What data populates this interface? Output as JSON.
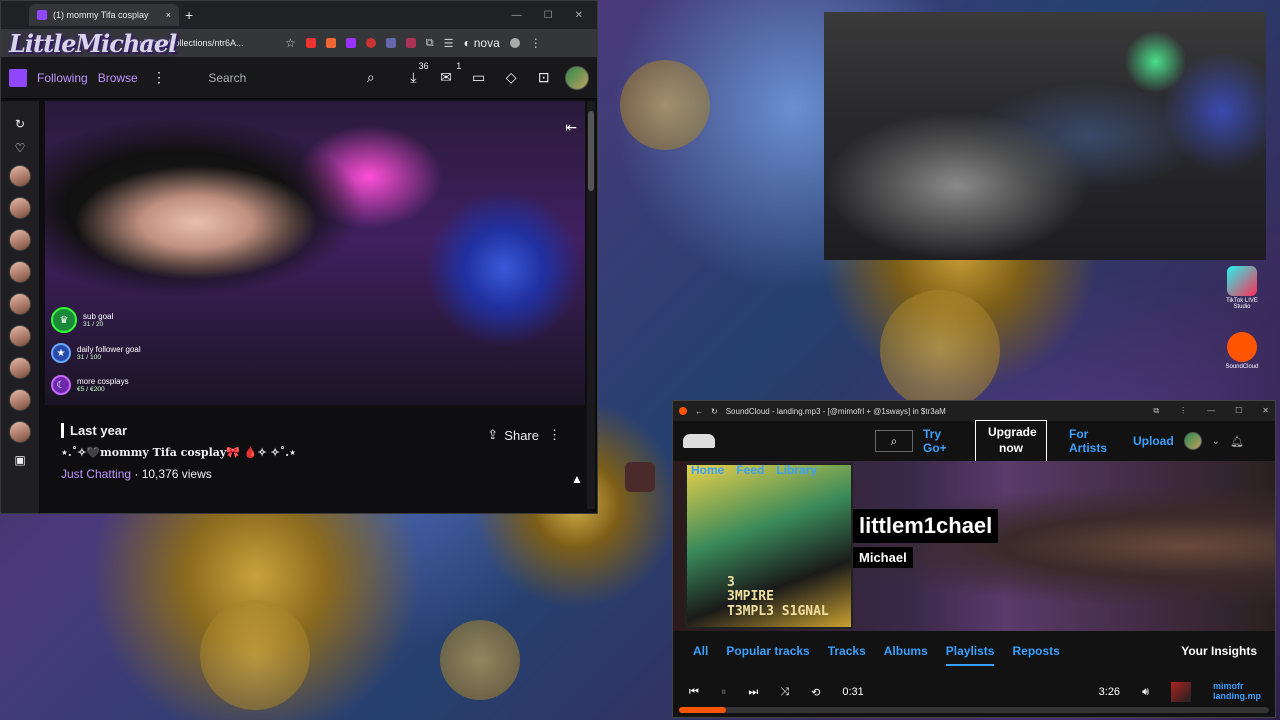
{
  "browser": {
    "tab_title": "(1) mommy Tifa cosplay",
    "tab_close": "×",
    "new_tab": "+",
    "url": "twitch.tv/collections/ntr6A...",
    "nova_label": "nova",
    "window_controls": [
      "—",
      "☐",
      "✕"
    ],
    "logo_text": "LittleMichael"
  },
  "twitch": {
    "nav": {
      "following": "Following",
      "browse": "Browse",
      "search_placeholder": "Search",
      "badge_count_a": "36",
      "badge_count_b": "1"
    },
    "goals": [
      {
        "label": "sub goal",
        "value": "31 / 20"
      },
      {
        "label": "daily follower goal",
        "value": "31 / 100"
      },
      {
        "label": "more cosplays",
        "value": "€5 / €200"
      }
    ],
    "video": {
      "when": "Last year",
      "title": "⋆.˚✧🖤mommy Tifa cosplay🎀 🩸✧ ✧˚.⋆",
      "category": "Just Chatting",
      "views": " · 10,376 views",
      "share_label": "Share"
    }
  },
  "desktop": {
    "tiktok_label": "TikTok LIVE Studio",
    "soundcloud_label": "SoundCloud"
  },
  "soundcloud": {
    "window_title": "SoundCloud - landing.mp3 - [@mimofrl + @1sways] in $tr3aM",
    "nav": {
      "try_go": "Try Go+",
      "upgrade": "Upgrade now",
      "for_artists": "For Artists",
      "upload": "Upload"
    },
    "banner_nav": [
      "Home",
      "Feed",
      "Library"
    ],
    "cover_text": "3\n3MPIRE\nT3MPL3 S1GNAL",
    "username": "littlem1chael",
    "real_name": "Michael",
    "tabs": [
      "All",
      "Popular tracks",
      "Tracks",
      "Albums",
      "Playlists",
      "Reposts"
    ],
    "active_tab": "Playlists",
    "insights": "Your Insights",
    "player": {
      "elapsed": "0:31",
      "duration": "3:26",
      "track_artist": "mimofr",
      "track_title": "landing.mp"
    }
  }
}
